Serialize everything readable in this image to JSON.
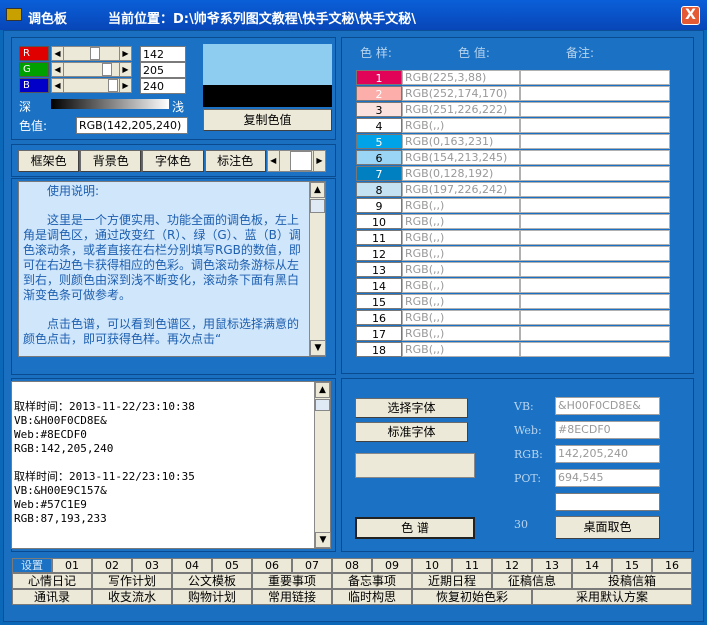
{
  "window": {
    "title": "调色板",
    "location": "当前位置：D:\\帅爷系列图文教程\\快手文秘\\快手文秘\\",
    "close_label": "X"
  },
  "mixer": {
    "r_label": "R",
    "g_label": "G",
    "b_label": "B",
    "r_value": "142",
    "g_value": "205",
    "b_value": "240",
    "r_level": 0.557,
    "g_level": 0.804,
    "b_level": 0.941,
    "dark_label": "深",
    "light_label": "浅",
    "color_value_label": "色值:",
    "color_value": "RGB(142,205,240)",
    "copy_button": "复制色值",
    "preview_color": "#8ECDF0"
  },
  "target_tabs": [
    "框架色",
    "背景色",
    "字体色",
    "标注色"
  ],
  "usage": {
    "title": "使用说明:",
    "paragraphs": [
      "这里是一个方便实用、功能全面的调色板，左上角是调色区，通过改变红（R）、绿（G）、蓝（B）调色滚动条，或者直接在右栏分别填写RGB的数值，即可在右边色卡获得相应的色彩。调色滚动条游标从左到右，则颜色由深到浅不断变化，滚动条下面有黑白渐变色条可做参考。",
      "点击色谱，可以看到色谱区，用鼠标选择满意的颜色点击，即可获得色样。再次点击“"
    ]
  },
  "swatches": {
    "header_sample": "色 样:",
    "header_value": "色 值:",
    "header_note": "备注:",
    "rows": [
      {
        "num": "1",
        "value": "RGB(225,3,88)",
        "color": "#E10358",
        "fg": "#ffffff"
      },
      {
        "num": "2",
        "value": "RGB(252,174,170)",
        "color": "#FCAEAA",
        "fg": "#ffffff"
      },
      {
        "num": "3",
        "value": "RGB(251,226,222)",
        "color": "#FBE2DE",
        "fg": "#000000"
      },
      {
        "num": "4",
        "value": "RGB(,,)",
        "color": "#ffffff",
        "fg": "#000000"
      },
      {
        "num": "5",
        "value": "RGB(0,163,231)",
        "color": "#00A3E7",
        "fg": "#ffffff"
      },
      {
        "num": "6",
        "value": "RGB(154,213,245)",
        "color": "#9AD5F5",
        "fg": "#000000"
      },
      {
        "num": "7",
        "value": "RGB(0,128,192)",
        "color": "#0080C0",
        "fg": "#ffffff"
      },
      {
        "num": "8",
        "value": "RGB(197,226,242)",
        "color": "#C5E2F2",
        "fg": "#000000"
      },
      {
        "num": "9",
        "value": "RGB(,,)",
        "color": "#ffffff",
        "fg": "#000000"
      },
      {
        "num": "10",
        "value": "RGB(,,)",
        "color": "#ffffff",
        "fg": "#000000"
      },
      {
        "num": "11",
        "value": "RGB(,,)",
        "color": "#ffffff",
        "fg": "#000000"
      },
      {
        "num": "12",
        "value": "RGB(,,)",
        "color": "#ffffff",
        "fg": "#000000"
      },
      {
        "num": "13",
        "value": "RGB(,,)",
        "color": "#ffffff",
        "fg": "#000000"
      },
      {
        "num": "14",
        "value": "RGB(,,)",
        "color": "#ffffff",
        "fg": "#000000"
      },
      {
        "num": "15",
        "value": "RGB(,,)",
        "color": "#ffffff",
        "fg": "#000000"
      },
      {
        "num": "16",
        "value": "RGB(,,)",
        "color": "#ffffff",
        "fg": "#000000"
      },
      {
        "num": "17",
        "value": "RGB(,,)",
        "color": "#ffffff",
        "fg": "#000000"
      },
      {
        "num": "18",
        "value": "RGB(,,)",
        "color": "#ffffff",
        "fg": "#000000"
      }
    ]
  },
  "log": {
    "entries": [
      [
        "取样时间：2013-11-22/23:10:38",
        "VB:&H00F0CD8E&",
        "Web:#8ECDF0",
        "RGB:142,205,240"
      ],
      [
        "取样时间：2013-11-22/23:10:35",
        "VB:&H00E9C157&",
        "Web:#57C1E9",
        "RGB:87,193,233"
      ]
    ]
  },
  "fonts": {
    "select_font": "选择字体",
    "standard_font": "标准字体",
    "spectrum_button": "色 谱",
    "count": "30",
    "desktop_pick": "桌面取色"
  },
  "codes": {
    "vb_label": "VB:",
    "vb_value": "&H00F0CD8E&",
    "web_label": "Web:",
    "web_value": "#8ECDF0",
    "rgb_label": "RGB:",
    "rgb_value": "142,205,240",
    "pot_label": "POT:",
    "pot_value": "694,545"
  },
  "bottom_tabs": [
    "设置",
    "01",
    "02",
    "03",
    "04",
    "05",
    "06",
    "07",
    "08",
    "09",
    "10",
    "11",
    "12",
    "13",
    "14",
    "15",
    "16"
  ],
  "commands_row1": [
    "心情日记",
    "写作计划",
    "公文模板",
    "重要事项",
    "备忘事项",
    "近期日程",
    "征稿信息",
    "投稿信箱"
  ],
  "commands_row2": [
    "通讯录",
    "收支流水",
    "购物计划",
    "常用链接",
    "临时构思",
    "恢复初始色彩",
    "采用默认方案"
  ]
}
